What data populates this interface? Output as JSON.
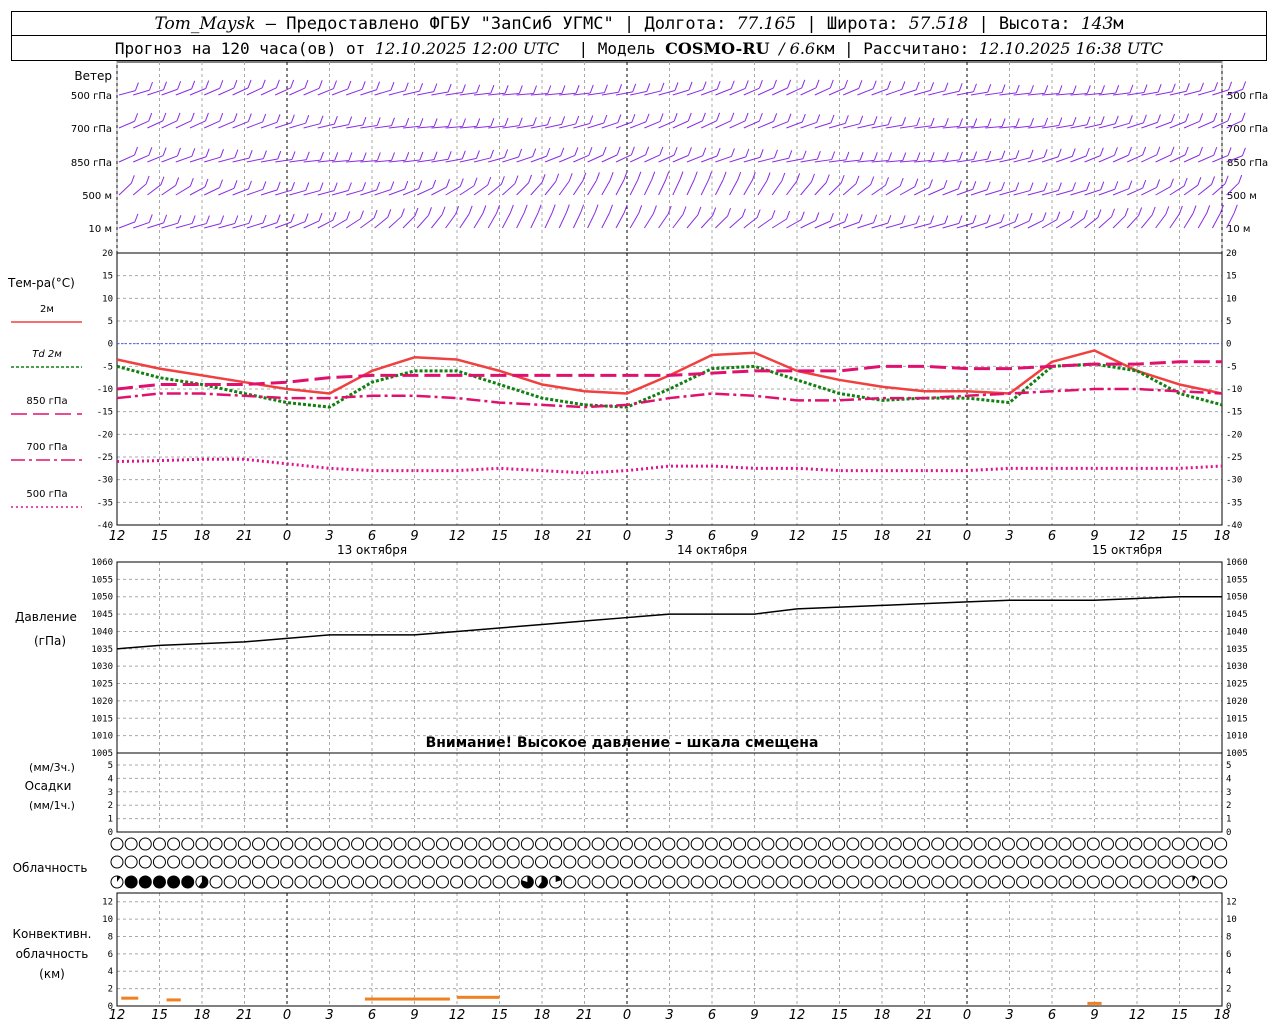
{
  "header": {
    "station": "Tom_Maysk",
    "provided_by": "– Предоставлено ФГБУ \"ЗапСиб УГМС\"",
    "lon_label": "Долгота:",
    "lon": "77.165",
    "lat_label": "Широта:",
    "lat": "57.518",
    "alt_label": "Высота:",
    "alt": "143",
    "alt_unit": "м",
    "forecast_label": "Прогноз на 120 часа(ов) от",
    "forecast_time": "12.10.2025 12:00 UTC",
    "model_label": "Модель",
    "model": "COSMO-RU",
    "resolution": "/ 6.6",
    "resolution_unit": "км",
    "calc_label": "Рассчитано:",
    "calc_time": "12.10.2025 16:38 UTC"
  },
  "colors": {
    "grid": "#a8a8a8",
    "wind": "#8a2be2",
    "t2m": "#f04040",
    "td2m": "#108010",
    "t850": "#e0106e",
    "t700": "#e0106e",
    "t500": "#e01090",
    "pressure": "#000000",
    "zero_line": "#4060ff",
    "conv": "#f08020"
  },
  "time_axis": {
    "ticks": [
      "12",
      "15",
      "18",
      "21",
      "0",
      "3",
      "6",
      "9",
      "12",
      "15",
      "18",
      "21",
      "0",
      "3",
      "6",
      "9",
      "12",
      "15",
      "18",
      "21",
      "0",
      "3",
      "6",
      "9",
      "12",
      "15",
      "18"
    ],
    "day_labels": [
      "13 октября",
      "14 октября",
      "15 октября"
    ]
  },
  "wind_panel": {
    "title": "Ветер",
    "levels": [
      "500 гПа",
      "700 гПа",
      "850 гПа",
      "500 м",
      "10  м"
    ]
  },
  "temp_panel": {
    "title": "Тем-ра(°C)",
    "legend": [
      "2м",
      "Td  2м",
      "850 гПа",
      "700 гПа",
      "500 гПа"
    ],
    "ticks": [
      "20",
      "15",
      "10",
      "5",
      "0",
      "-5",
      "-10",
      "-15",
      "-20",
      "-25",
      "-30",
      "-35",
      "-40"
    ]
  },
  "pressure_panel": {
    "title": "Давление",
    "unit": "(гПа)",
    "ticks": [
      "1060",
      "1055",
      "1050",
      "1045",
      "1040",
      "1035",
      "1030",
      "1025",
      "1020",
      "1015",
      "1010",
      "1005"
    ],
    "warning": "Внимание! Высокое давление – шкала смещена"
  },
  "precip_panel": {
    "unit_3h": "(мм/3ч.)",
    "title": "Осадки",
    "unit_1h": "(мм/1ч.)",
    "ticks": [
      "5",
      "4",
      "3",
      "2",
      "1",
      "0"
    ]
  },
  "cloud_panel": {
    "title": "Облачность"
  },
  "conv_panel": {
    "title1": "Конвективн.",
    "title2": "облачность",
    "unit": "(км)",
    "ticks": [
      "12",
      "10",
      "8",
      "6",
      "4",
      "2",
      "0"
    ]
  },
  "chart_data": {
    "type": "line",
    "x_unit": "hours since 12.10.2025 12:00 UTC",
    "x": [
      0,
      3,
      6,
      9,
      12,
      15,
      18,
      21,
      24,
      27,
      30,
      33,
      36,
      39,
      42,
      45,
      48,
      51,
      54,
      57,
      60,
      63,
      66,
      69,
      72,
      75,
      78
    ],
    "series": [
      {
        "name": "2м",
        "panel": "temperature",
        "values": [
          -3.5,
          -5.5,
          -7,
          -8.5,
          -10,
          -11,
          -6,
          -3,
          -3.5,
          -6,
          -9,
          -10.5,
          -11,
          -7,
          -2.5,
          -2,
          -6,
          -8,
          -9.5,
          -10.5,
          -10.5,
          -11,
          -4,
          -1.5,
          -6,
          -9,
          -11
        ]
      },
      {
        "name": "Td  2м",
        "panel": "temperature",
        "values": [
          -5,
          -7.5,
          -9,
          -11,
          -13,
          -14,
          -8.5,
          -6,
          -6,
          -9,
          -12,
          -13.5,
          -14,
          -10,
          -5.5,
          -5,
          -8,
          -11,
          -12.5,
          -12,
          -12,
          -13,
          -5,
          -4.5,
          -6,
          -11,
          -13.5
        ]
      },
      {
        "name": "850 гПа",
        "panel": "temperature",
        "values": [
          -10,
          -9,
          -9,
          -9,
          -8.5,
          -7.5,
          -7,
          -7,
          -7,
          -7,
          -7,
          -7,
          -7,
          -7,
          -6.5,
          -6,
          -6,
          -6,
          -5,
          -5,
          -5.5,
          -5.5,
          -5,
          -4.5,
          -4.5,
          -4,
          -4
        ]
      },
      {
        "name": "700 гПа",
        "panel": "temperature",
        "values": [
          -12,
          -11,
          -11,
          -11.5,
          -12,
          -12,
          -11.5,
          -11.5,
          -12,
          -13,
          -13.5,
          -14,
          -13.5,
          -12,
          -11,
          -11.5,
          -12.5,
          -12.5,
          -12,
          -12,
          -11.5,
          -11,
          -10.5,
          -10,
          -10,
          -10.5,
          -11
        ]
      },
      {
        "name": "500 гПа",
        "panel": "temperature",
        "values": [
          -26,
          -25.8,
          -25.5,
          -25.5,
          -26.5,
          -27.5,
          -28,
          -28,
          -28,
          -27.5,
          -28,
          -28.5,
          -28,
          -27,
          -27,
          -27.5,
          -27.5,
          -28,
          -28,
          -28,
          -28,
          -27.5,
          -27.5,
          -27.5,
          -27.5,
          -27.5,
          -27
        ]
      },
      {
        "name": "Давление",
        "panel": "pressure",
        "values": [
          1035,
          1036,
          1036.5,
          1037,
          1038,
          1039,
          1039,
          1039,
          1040,
          1041,
          1042,
          1043,
          1044,
          1045,
          1045,
          1045,
          1046.5,
          1047,
          1047.5,
          1048,
          1048.5,
          1049,
          1049,
          1049,
          1049.5,
          1050,
          1050
        ]
      }
    ],
    "precipitation": [
      0,
      0,
      0,
      0,
      0,
      0,
      0,
      0,
      0,
      0,
      0,
      0,
      0,
      0,
      0,
      0,
      0,
      0,
      0,
      0,
      0,
      0,
      0,
      0,
      0,
      0,
      0
    ],
    "convective_cloud": [
      {
        "x0": 0.3,
        "x1": 1.5,
        "km": 0.9
      },
      {
        "x0": 3.5,
        "x1": 4.5,
        "km": 0.7
      },
      {
        "x0": 17.5,
        "x1": 23.5,
        "km": 0.8
      },
      {
        "x0": 24,
        "x1": 27,
        "km": 1.0
      },
      {
        "x0": 68.5,
        "x1": 69.5,
        "km": 0.3
      }
    ],
    "cloud_rows": {
      "high": [
        0,
        0,
        0,
        0,
        0,
        0,
        0,
        0,
        0,
        0,
        0,
        0,
        0,
        0,
        0,
        0,
        0,
        0,
        0,
        0,
        0,
        0,
        0,
        0,
        0,
        0,
        0,
        0,
        0,
        0,
        0,
        0,
        0,
        0,
        0,
        0,
        0,
        0,
        0,
        0,
        0,
        0,
        0,
        0,
        0,
        0,
        0,
        0,
        0,
        0,
        0,
        0,
        0,
        0,
        0,
        0,
        0,
        0,
        0,
        0,
        0,
        0,
        0,
        0,
        0,
        0,
        0,
        0,
        0,
        0,
        0,
        0,
        0,
        0,
        0,
        0,
        0,
        0,
        0
      ],
      "middle": [
        0,
        0,
        0,
        0,
        0,
        0,
        0,
        0,
        0,
        0,
        0,
        0,
        0,
        0,
        0,
        0,
        0,
        0,
        0,
        0,
        0,
        0,
        0,
        0,
        0,
        0,
        0,
        0,
        0,
        0,
        0,
        0,
        0,
        0,
        0,
        0,
        0,
        0,
        0,
        0,
        0,
        0,
        0,
        0,
        0,
        0,
        0,
        0,
        0,
        0,
        0,
        0,
        0,
        0,
        0,
        0,
        0,
        0,
        0,
        0,
        0,
        0,
        0,
        0,
        0,
        0,
        0,
        0,
        0,
        0,
        0,
        0,
        0,
        0,
        0,
        0,
        0,
        0,
        0
      ],
      "low": [
        0.1,
        1,
        1,
        1,
        1,
        1,
        0.6,
        0,
        0,
        0,
        0,
        0,
        0,
        0,
        0,
        0,
        0,
        0,
        0,
        0,
        0,
        0,
        0,
        0,
        0,
        0,
        0,
        0,
        0,
        0.8,
        0.6,
        0.2,
        0,
        0,
        0,
        0,
        0,
        0,
        0,
        0,
        0,
        0,
        0,
        0,
        0,
        0,
        0,
        0,
        0,
        0,
        0,
        0,
        0,
        0,
        0,
        0,
        0,
        0,
        0,
        0,
        0,
        0,
        0,
        0,
        0,
        0,
        0,
        0,
        0,
        0,
        0,
        0,
        0,
        0,
        0,
        0,
        0.1,
        0,
        0
      ]
    },
    "temp_ylim": [
      -40,
      20
    ],
    "pressure_ylim": [
      1005,
      1060
    ],
    "precip_ylim": [
      0,
      5
    ],
    "conv_ylim": [
      0,
      13
    ],
    "grid": true
  }
}
